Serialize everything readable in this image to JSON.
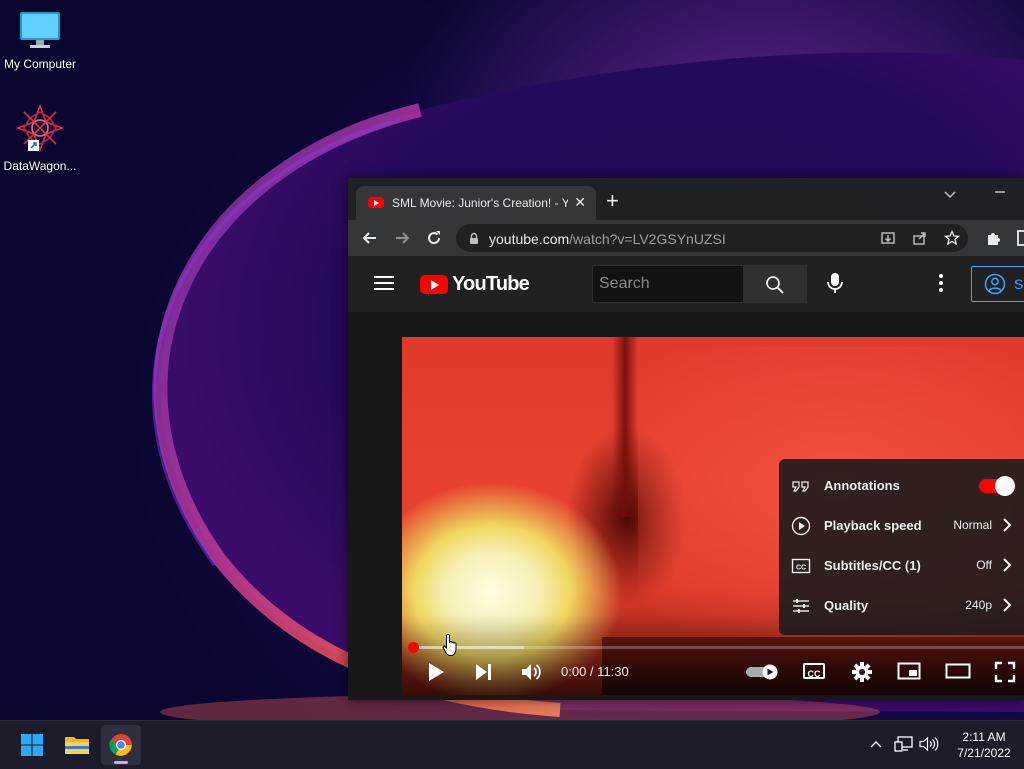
{
  "desktop": {
    "icons": [
      {
        "label": "My Computer",
        "icon": "computer-monitor-icon"
      },
      {
        "label": "DataWagon...",
        "icon": "datawagon-app-icon"
      }
    ]
  },
  "browser": {
    "tab_title": "SML Movie: Junior's Creation! - Y",
    "tab_close": "✕",
    "new_tab": "+",
    "url_host": "youtube.com",
    "url_path": "/watch?v=LV2GSYnUZSI"
  },
  "youtube": {
    "logo_text": "YouTube",
    "search_placeholder": "Search",
    "signin_label": "S"
  },
  "player": {
    "time": "0:00 / 11:30",
    "progress_fraction": 0.0,
    "buffered_fraction": 0.18,
    "settings_menu": [
      {
        "label": "Annotations",
        "value": "",
        "icon": "annotations-icon",
        "toggle_on": true
      },
      {
        "label": "Playback speed",
        "value": "Normal",
        "icon": "playback-speed-icon"
      },
      {
        "label": "Subtitles/CC (1)",
        "value": "Off",
        "icon": "subtitles-icon"
      },
      {
        "label": "Quality",
        "value": "240p",
        "icon": "quality-sliders-icon"
      }
    ],
    "cc_label": "CC"
  },
  "taskbar": {
    "time": "2:11 AM",
    "date": "7/21/2022",
    "accent": "#c9a7ff"
  }
}
